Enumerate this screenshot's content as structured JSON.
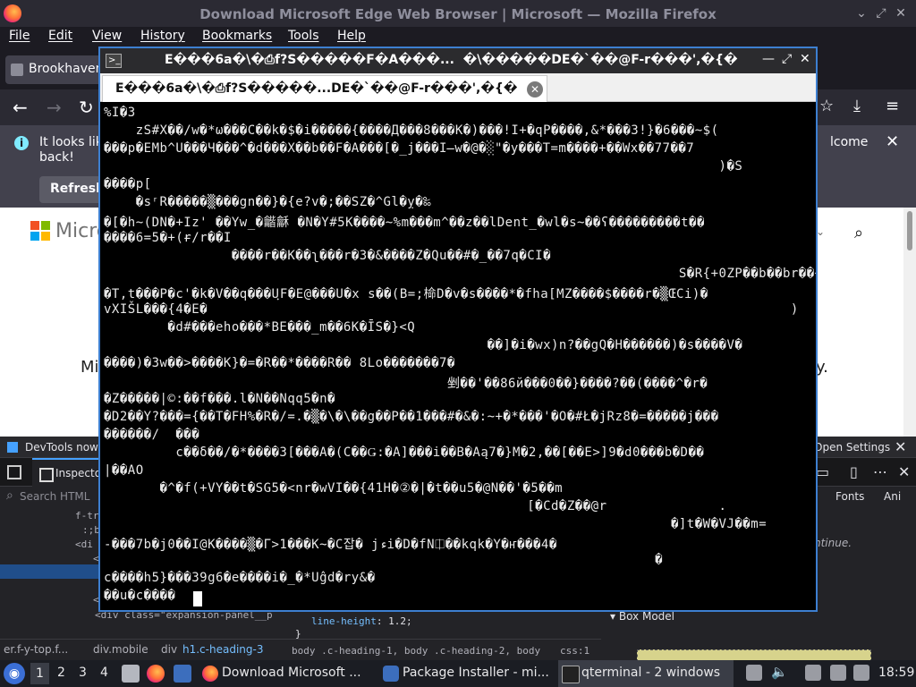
{
  "firefox": {
    "window_title": "Download Microsoft Edge Web Browser | Microsoft — Mozilla Firefox",
    "menu": [
      "File",
      "Edit",
      "View",
      "History",
      "Bookmarks",
      "Tools",
      "Help"
    ],
    "tab_label": "Brookhaven",
    "notification": {
      "line1": "It looks lik",
      "line2": "back!",
      "right_text": "lcome",
      "refresh_label": "Refresh"
    },
    "page": {
      "brand_text": "Micro",
      "body_text_left": "Mi",
      "body_text_right": "y."
    },
    "devtools": {
      "banner_text": "DevTools now f",
      "open_settings": "Open Settings",
      "inspector_tab": "Inspecto",
      "search_placeholder": "Search HTML",
      "fonts_tab": "Fonts",
      "animations_tab": "Ani",
      "continue_text": "ntinue.",
      "tree_lines": [
        "f-tr",
        ":;b",
        "<di",
        "<",
        "",
        "<"
      ],
      "expansion_line": "<div class=\"expansion-panel__p",
      "rule_line_prop": "line-height",
      "rule_line_val": "1.2;",
      "rule_brace": "}",
      "box_model": "Box Model",
      "breadcrumb": [
        "er.f-y-top.f...",
        "div.mobile",
        "div",
        "h1.c-heading-3"
      ],
      "selector_list": "body .c-heading-1, body .c-heading-2, body",
      "css_source": "css:1"
    }
  },
  "terminal": {
    "window_title": "E���6a�\\�⎙f?S�����F�A���...  �\\�����DE�`��@F-r���',�{�",
    "tab_label": "E���6a�\\�⎙f?S�����...DE�`��@F-r���',�{�",
    "lines": [
      "%I�3",
      "    zS#X��/w�*ω���C��k�$�i�����{����Д���8���K�)���!I+�qP����,&*���3!}�6���~$(",
      "���p�EMb^U���Ч���^�d���X��b��F�A���[�_j���I̶w�@�░\"�y���T=m����+��Wx��77��7",
      "                                                                             )�S",
      "����p[",
      "    �sʳR�����▒���gn��}�{e?v�;��SZ�^Gl�ỵ�‰",
      "�[�h~(DN�+Iz' ��Yw_�龤龢 �N�Y#5K����~%m���m^��z��lDent_�wl�s~��ʕ���������t��",
      "����6=5�+(ɍ/r��I",
      "                ����r��K��ʅ���r�3�&����Z�Qu��#�_��7q�CI�",
      "                                                                        S�R{+0ZP��b��br��+�b�",
      "�T,t���P�c'�k�V��q���UฺF�E@���U�x s��(B=;椧D�v�s����*�fha[MZ����$����r�▒ŒCi)�",
      "vXIŠL���{4�E�                                                                         )",
      "        �d#���eho���*BE���_m��6K�ĪS�}<Q",
      "                                                ��]�i�wx)n?��gQ�H������)�s����V�",
      "����)�3w��>����K}�=�R��*����R�� 8Lo�������7�",
      "                                           剉��'��86й���0��}����?��(����^�r�",
      "�Z�����|©:��f���.l�N��Nqq5�n�",
      "�D2��Y?���={��T�FH%�R�/=.�▒�\\�\\��g��P��1���#�&�:~+�*���'�O�#Ł�jRz8�=�����j���",
      "������/  ���",
      "         c��δ��/�*����3[���A�(C��Ǥ:�A]���i��B�Αą7�}M�2,��[��E>]9�d0���b�D��",
      "|��AO",
      "       �^�f(+VY��t�SG5�<nr�wVI��{41H�②�|�t��u5�@N��'�5��m",
      "                                                     [�Cd�Z��@r              .",
      "                                                                       �]t�W�VJ��m=",
      "-���7b�j0��I@K����▒�Γ>1���K~�C잡� jءi�D�fN⎅��kqk�Y�ҥ���4�",
      "                                                                     �",
      "c����h5}���39g6�e����i�_�*Uĝd�ry&�",
      "��u�c����"
    ]
  },
  "taskbar": {
    "workspaces": [
      "1",
      "2",
      "3",
      "4"
    ],
    "tasks": [
      {
        "label": "Download Microsoft ...",
        "kind": "ff"
      },
      {
        "label": "Package Installer - mi...",
        "kind": "pk"
      },
      {
        "label": "qterminal - 2 windows",
        "kind": "qt"
      }
    ],
    "clock": "18:59"
  }
}
